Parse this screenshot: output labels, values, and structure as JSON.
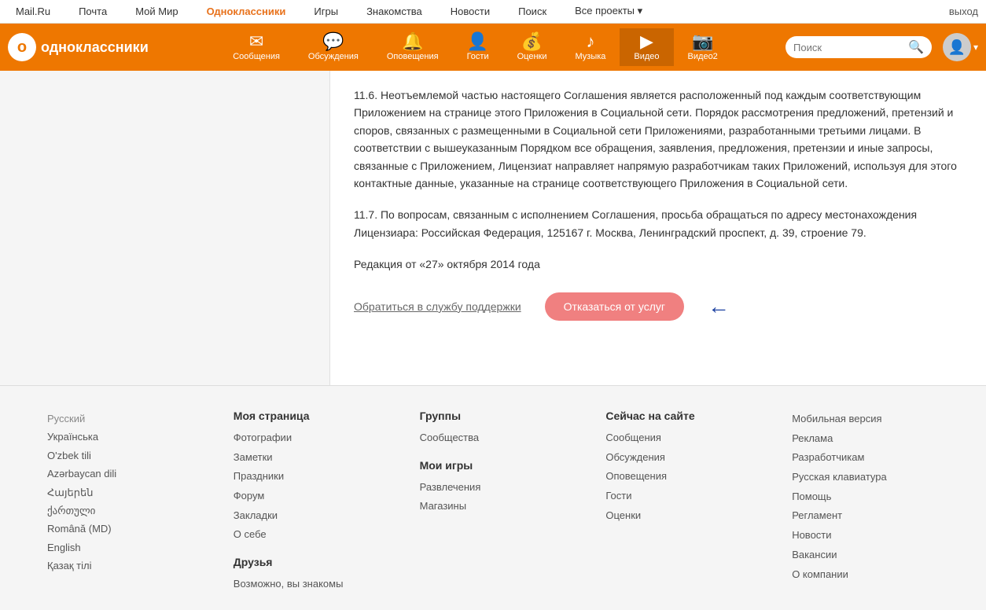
{
  "topnav": {
    "items": [
      {
        "label": "Mail.Ru",
        "active": false
      },
      {
        "label": "Почта",
        "active": false
      },
      {
        "label": "Мой Мир",
        "active": false
      },
      {
        "label": "Одноклассники",
        "active": true
      },
      {
        "label": "Игры",
        "active": false
      },
      {
        "label": "Знакомства",
        "active": false
      },
      {
        "label": "Новости",
        "active": false
      },
      {
        "label": "Поиск",
        "active": false
      },
      {
        "label": "Все проекты",
        "active": false
      }
    ],
    "logout": "выход"
  },
  "header": {
    "logo_text": "одноклассники",
    "search_placeholder": "Поиск",
    "nav_items": [
      {
        "label": "Сообщения",
        "icon": "✉"
      },
      {
        "label": "Обсуждения",
        "icon": "💬"
      },
      {
        "label": "Оповещения",
        "icon": "🔔"
      },
      {
        "label": "Гости",
        "icon": "👤"
      },
      {
        "label": "Оценки",
        "icon": "💰"
      },
      {
        "label": "Музыка",
        "icon": "♪"
      },
      {
        "label": "Видео",
        "icon": "▶"
      },
      {
        "label": "Видео2",
        "icon": "📷"
      }
    ]
  },
  "content": {
    "para1": "11.6. Неотъемлемой частью настоящего Соглашения является расположенный под каждым соответствующим Приложением на странице этого Приложения в Социальной сети. Порядок рассмотрения предложений, претензий и споров, связанных с размещенными в Социальной сети Приложениями, разработанными третьими лицами. В соответствии с вышеуказанным Порядком все обращения, заявления, предложения, претензии и иные запросы, связанные с Приложением, Лицензиат направляет напрямую разработчикам таких Приложений, используя для этого контактные данные, указанные на странице соответствующего Приложения в Социальной сети.",
    "para2": "11.7. По вопросам, связанным с исполнением Соглашения, просьба обращаться по адресу местонахождения Лицензиара: Российская Федерация, 125167 г. Москва, Ленинградский проспект, д. 39, строение 79.",
    "para3": "Редакция от «27» октября 2014 года",
    "support_link": "Обратиться в службу поддержки",
    "cancel_btn": "Отказаться от услуг"
  },
  "footer": {
    "languages": [
      {
        "label": "Русский",
        "active": true
      },
      {
        "label": "Українська",
        "active": false
      },
      {
        "label": "O'zbek tili",
        "active": false
      },
      {
        "label": "Azərbaycan dili",
        "active": false
      },
      {
        "label": "Հայերեն",
        "active": false
      },
      {
        "label": "ქართული",
        "active": false
      },
      {
        "label": "Română (MD)",
        "active": false
      },
      {
        "label": "English",
        "active": false
      },
      {
        "label": "Қазақ тілі",
        "active": false
      }
    ],
    "col_my_page": {
      "title": "Моя страница",
      "links": [
        "Фотографии",
        "Заметки",
        "Праздники",
        "Форум",
        "Закладки",
        "О себе"
      ]
    },
    "col_friends": {
      "title": "Друзья",
      "links": [
        "Возможно, вы знакомы"
      ]
    },
    "col_groups": {
      "title": "Группы",
      "links": [
        "Сообщества"
      ]
    },
    "col_my_games": {
      "title": "Мои игры",
      "links": [
        "Развлечения",
        "Магазины"
      ]
    },
    "col_now": {
      "title": "Сейчас на сайте",
      "links": [
        "Сообщения",
        "Обсуждения",
        "Оповещения",
        "Гости",
        "Оценки"
      ]
    },
    "col_misc": {
      "links": [
        "Мобильная версия",
        "Реклама",
        "Разработчикам",
        "Русская клавиатура",
        "Помощь",
        "Регламент",
        "Новости",
        "Вакансии",
        "О компании"
      ]
    }
  }
}
